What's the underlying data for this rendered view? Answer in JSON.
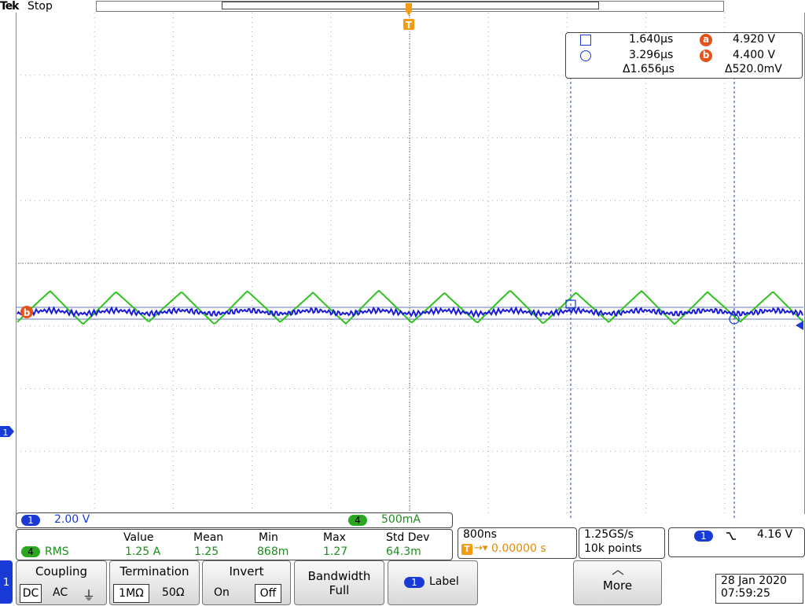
{
  "status": {
    "brand": "Tek",
    "state": "Stop"
  },
  "trigger_marker": "T",
  "cursor_readout": {
    "row1_time": "1.640µs",
    "row1_label": "a",
    "row1_value": "4.920 V",
    "row2_time": "3.296µs",
    "row2_label": "b",
    "row2_value": "4.400 V",
    "delta_time": "Δ1.656µs",
    "delta_value": "Δ520.0mV"
  },
  "waveform_labels": {
    "ch1_marker": "1",
    "ref_b": "b"
  },
  "channels": {
    "ch1_num": "1",
    "ch1_scale": "2.00 V",
    "ch4_num": "4",
    "ch4_scale": "500mA"
  },
  "measurement": {
    "source_num": "4",
    "type": "RMS",
    "headers": [
      "Value",
      "Mean",
      "Min",
      "Max",
      "Std Dev"
    ],
    "values": [
      "1.25 A",
      "1.25",
      "868m",
      "1.27",
      "64.3m"
    ]
  },
  "timebase": {
    "scale": "800ns",
    "position": "0.00000 s",
    "trig_icon": "T"
  },
  "acquisition": {
    "rate": "1.25GS/s",
    "points": "10k points"
  },
  "trigger": {
    "source": "1",
    "slope_icon": "falling-edge-icon",
    "level": "4.16 V"
  },
  "menu": {
    "side_tab": "1",
    "coupling": {
      "title": "Coupling",
      "options": [
        "DC",
        "AC",
        "⏚"
      ]
    },
    "termination": {
      "title": "Termination",
      "options": [
        "1MΩ",
        "50Ω"
      ]
    },
    "invert": {
      "title": "Invert",
      "options": [
        "On",
        "Off"
      ]
    },
    "bandwidth": {
      "title": "Bandwidth",
      "value": "Full"
    },
    "label": {
      "num": "1",
      "title": "Label"
    },
    "more": {
      "title": "More"
    }
  },
  "datetime": {
    "date": "28 Jan  2020",
    "time": "07:59:25"
  },
  "colors": {
    "ch1": "#1a1ad6",
    "ch4": "#2ec21e",
    "cursor": "#1a3ad6",
    "ref": "#e8501a"
  }
}
